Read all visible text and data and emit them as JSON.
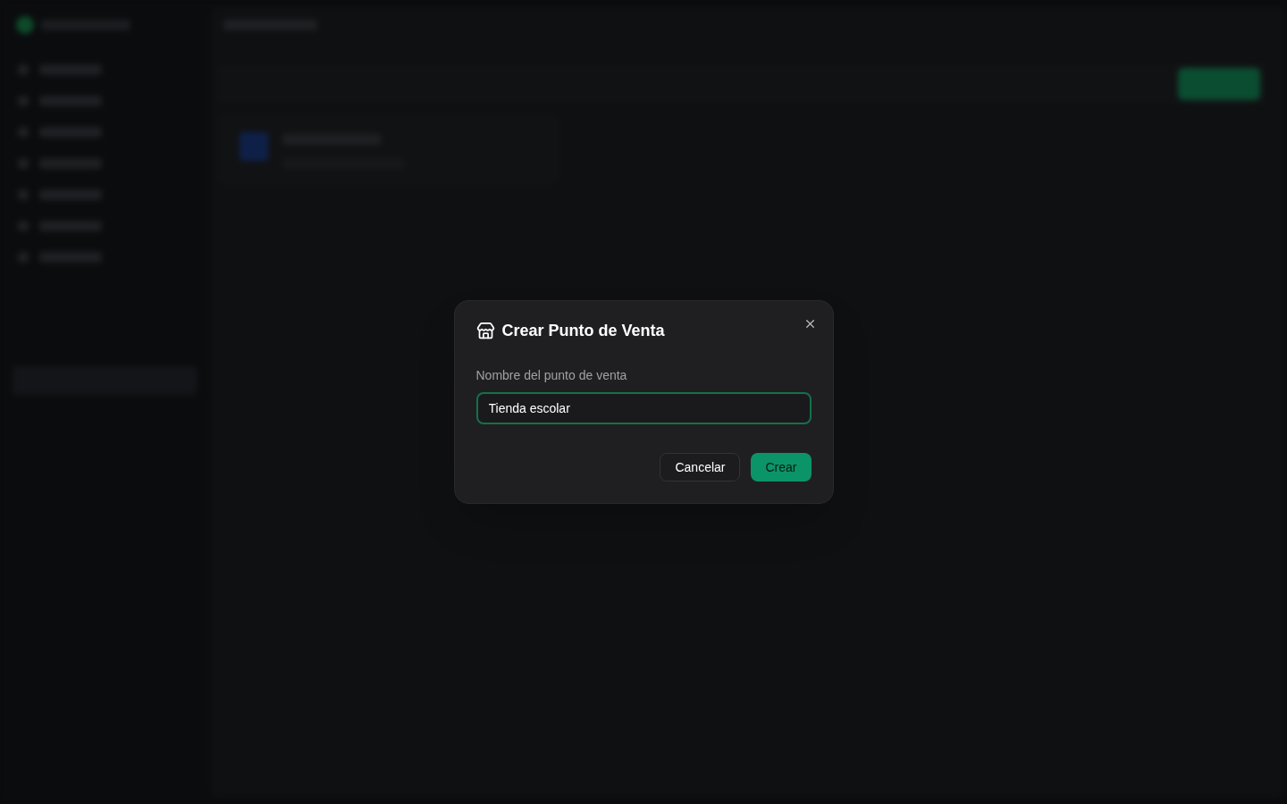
{
  "dialog": {
    "title": "Crear Punto de Venta",
    "field": {
      "label": "Nombre del punto de venta",
      "value": "Tienda escolar",
      "focused": true
    },
    "buttons": [
      {
        "label": "Cancelar",
        "kind": "secondary"
      },
      {
        "label": "Crear",
        "kind": "primary"
      }
    ]
  }
}
